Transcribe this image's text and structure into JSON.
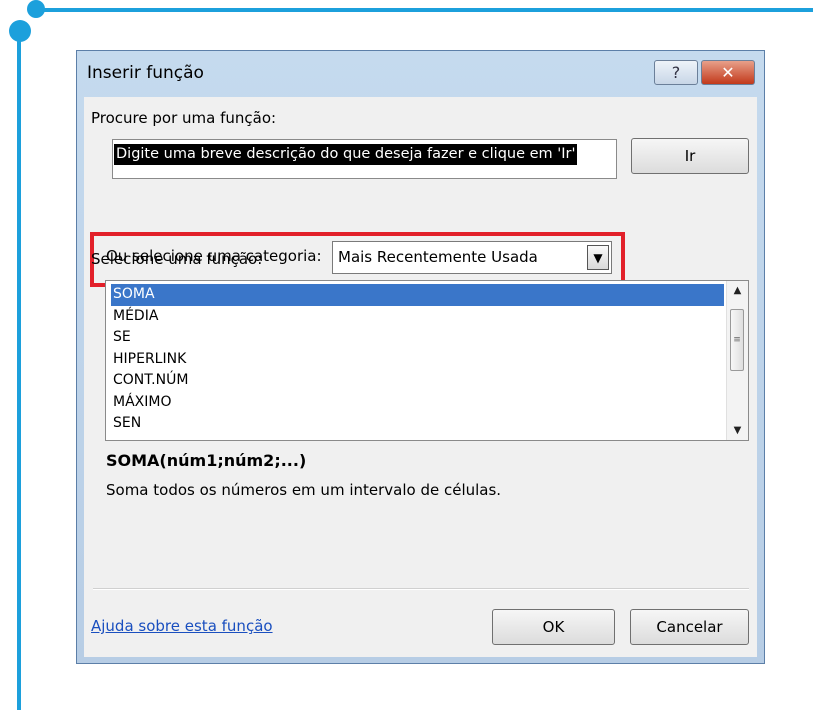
{
  "window": {
    "title": "Inserir função",
    "help_glyph": "?",
    "close_glyph": "✕"
  },
  "search": {
    "label": "Procure por uma função:",
    "value": "Digite uma breve descrição do que deseja fazer e clique em 'Ir'",
    "go_label": "Ir"
  },
  "category": {
    "label": "Ou selecione uma categoria:",
    "value": "Mais Recentemente Usada",
    "highlight_color": "#e2202a"
  },
  "functions": {
    "label": "Selecione uma função:",
    "items": [
      "SOMA",
      "MÉDIA",
      "SE",
      "HIPERLINK",
      "CONT.NÚM",
      "MÁXIMO",
      "SEN"
    ],
    "selected": "SOMA"
  },
  "details": {
    "syntax": "SOMA(núm1;núm2;...)",
    "description": "Soma todos os números em um intervalo de células."
  },
  "footer": {
    "help_link": "Ajuda sobre esta função",
    "ok_label": "OK",
    "cancel_label": "Cancelar"
  },
  "colors": {
    "accent_decoration": "#1ca0dc",
    "selection": "#3a76c9",
    "link": "#1a4fbf"
  }
}
